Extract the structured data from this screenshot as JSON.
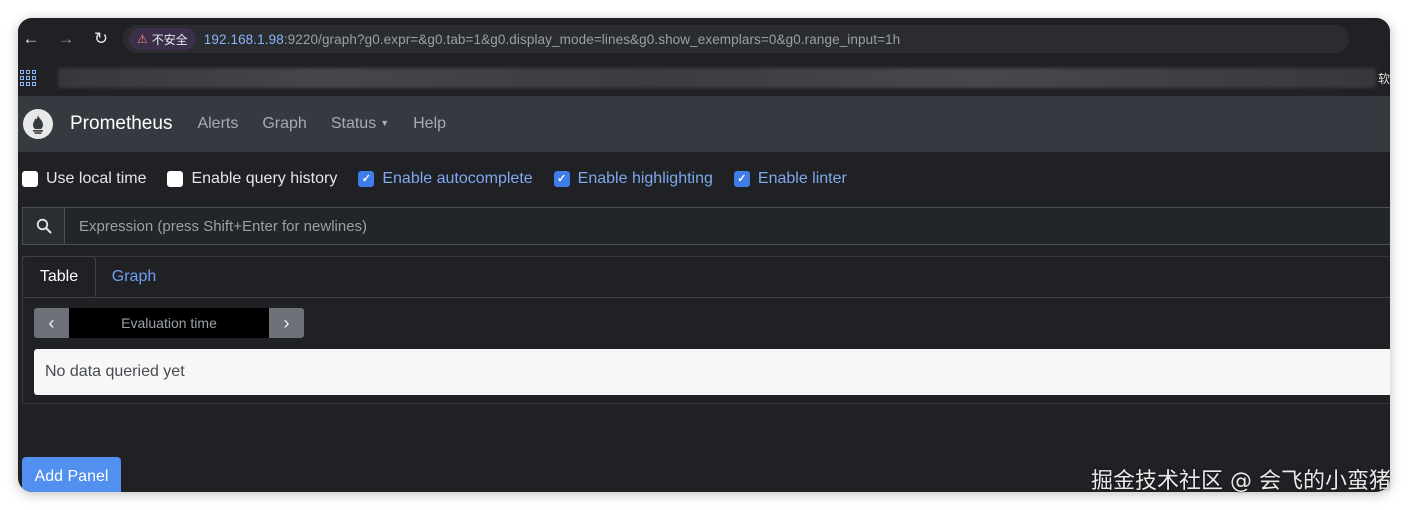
{
  "browser": {
    "insecure_badge": "不安全",
    "url_host": "192.168.1.98",
    "url_rest": ":9220/graph?g0.expr=&g0.tab=1&g0.display_mode=lines&g0.show_exemplars=0&g0.range_input=1h",
    "bookmark_cut_text": "软"
  },
  "navbar": {
    "brand": "Prometheus",
    "links": [
      "Alerts",
      "Graph",
      "Status",
      "Help"
    ]
  },
  "options": [
    {
      "label": "Use local time",
      "checked": false
    },
    {
      "label": "Enable query history",
      "checked": false
    },
    {
      "label": "Enable autocomplete",
      "checked": true
    },
    {
      "label": "Enable highlighting",
      "checked": true
    },
    {
      "label": "Enable linter",
      "checked": true
    }
  ],
  "expression": {
    "placeholder": "Expression (press Shift+Enter for newlines)",
    "value": ""
  },
  "panel": {
    "tabs": [
      "Table",
      "Graph"
    ],
    "active_tab": "Table",
    "eval_placeholder": "Evaluation time",
    "prev_symbol": "‹",
    "next_symbol": "›",
    "empty_message": "No data queried yet"
  },
  "add_panel_label": "Add Panel",
  "watermark": "掘金技术社区 @ 会飞的小蛮猪",
  "colors": {
    "background": "#1f2125",
    "navbar": "#343a40",
    "checkbox_on": "#3f7ee8",
    "link_blue": "#6f9ef0",
    "add_panel": "#5290f0"
  }
}
